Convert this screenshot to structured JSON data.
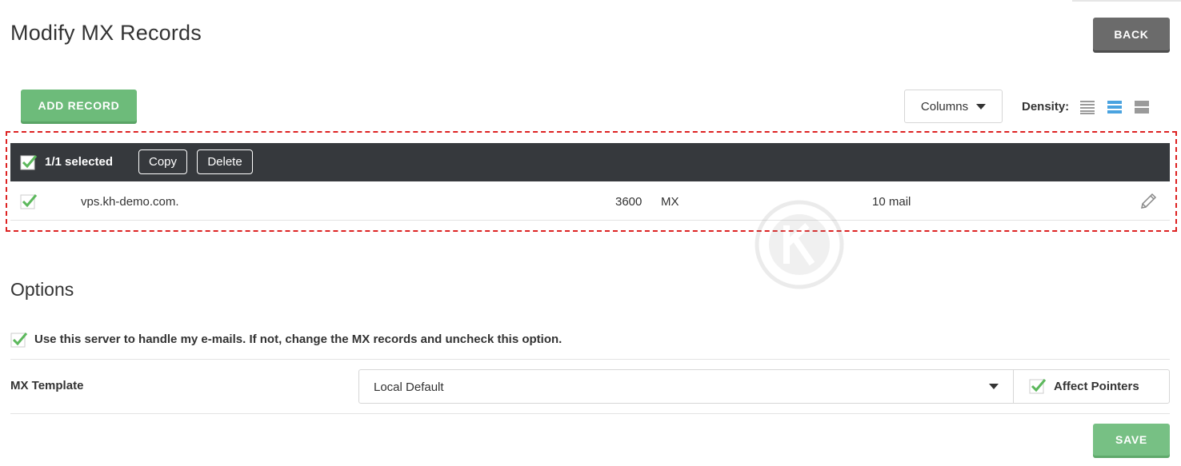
{
  "page": {
    "title": "Modify MX Records",
    "back_label": "BACK"
  },
  "toolbar": {
    "add_record_label": "ADD RECORD",
    "columns_label": "Columns",
    "density_label": "Density:",
    "density_selected": "medium"
  },
  "selection_bar": {
    "count_text": "1/1 selected",
    "copy_label": "Copy",
    "delete_label": "Delete"
  },
  "records": [
    {
      "name": "vps.kh-demo.com.",
      "ttl": "3600",
      "type": "MX",
      "value": "10 mail",
      "checked": true
    }
  ],
  "options": {
    "title": "Options",
    "use_server_label": "Use this server to handle my e-mails. If not, change the MX records and uncheck this option.",
    "use_server_checked": true,
    "mx_template_label": "MX Template",
    "mx_template_value": "Local Default",
    "affect_pointers_label": "Affect Pointers",
    "affect_pointers_checked": true,
    "save_label": "SAVE"
  },
  "colors": {
    "accent_green": "#6dbb7a",
    "dark_bar": "#36393d",
    "highlight_dash": "#dd2222",
    "density_active": "#4aa3e0"
  }
}
